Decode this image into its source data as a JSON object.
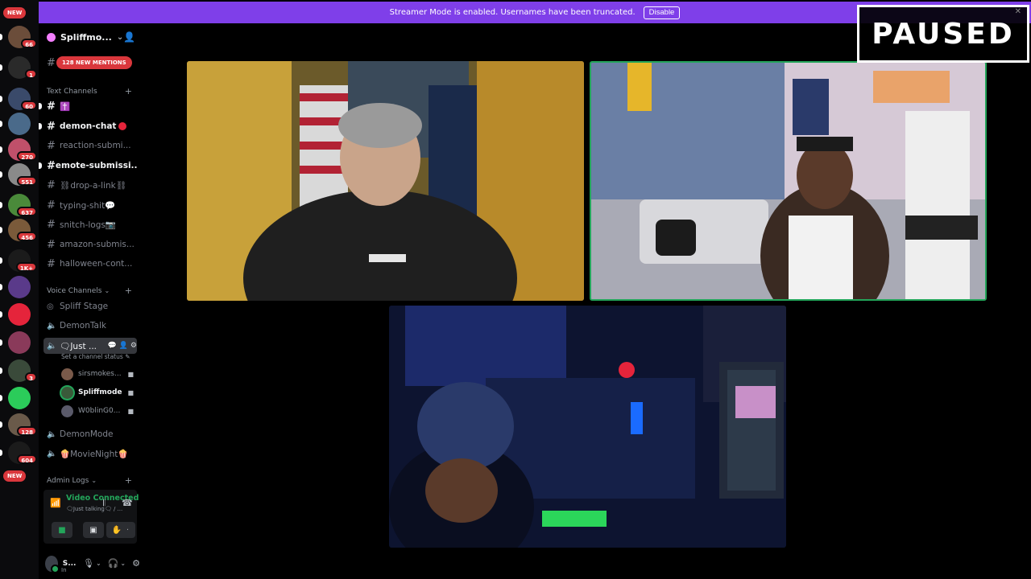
{
  "banner": {
    "text": "Streamer Mode is enabled. Usernames have been truncated.",
    "button": "Disable"
  },
  "overlay": {
    "paused": "PAUSED"
  },
  "rail": {
    "top_badge": "NEW",
    "servers": [
      {
        "badge": "66",
        "color": "#6b4d3a"
      },
      {
        "badge": "1",
        "color": "#2a2a2a"
      },
      {
        "badge": "60",
        "color": "#3a4a6a"
      },
      {
        "badge": "",
        "color": "#4a6a8a"
      },
      {
        "badge": "270",
        "color": "#c0506a"
      },
      {
        "badge": "551",
        "color": "#8a8a8a"
      },
      {
        "badge": "637",
        "color": "#4a8a3a"
      },
      {
        "badge": "456",
        "color": "#7a5a3a"
      },
      {
        "badge": "1K+",
        "color": "#1b1b1b"
      },
      {
        "badge": "",
        "color": "#5a3a8a"
      },
      {
        "badge": "",
        "color": "#e5243b"
      },
      {
        "badge": "",
        "color": "#8a3a5a"
      },
      {
        "badge": "3",
        "color": "#3a4a3a"
      },
      {
        "badge": "",
        "color": "#2bcc5a"
      },
      {
        "badge": "128",
        "color": "#6a5a4a"
      },
      {
        "badge": "604",
        "color": "#1b1b1b"
      }
    ],
    "bottom_badge": "NEW"
  },
  "sidebar": {
    "server_name": "Spliffmo...",
    "mentions": "128 NEW MENTIONS",
    "text_category": "Text Channels",
    "text_channels": [
      {
        "name": "✝️",
        "unread": true
      },
      {
        "name": "demon-chat",
        "unread": true
      },
      {
        "name": "reaction-submi...",
        "unread": false
      },
      {
        "name": "emote-submissi...",
        "unread": true
      },
      {
        "name": "⛓drop-a-link⛓",
        "unread": false
      },
      {
        "name": "typing-shit💬",
        "unread": false
      },
      {
        "name": "snitch-logs📷",
        "unread": false
      },
      {
        "name": "amazon-submis...",
        "unread": false
      },
      {
        "name": "halloween-cont...",
        "unread": false
      }
    ],
    "voice_category": "Voice Channels",
    "voice_channels": [
      {
        "name": "Spliff Stage"
      },
      {
        "name": "DemonTalk"
      },
      {
        "name": "🗨Just ...",
        "active": true
      }
    ],
    "channel_status": "Set a channel status",
    "voice_users": [
      {
        "name": "sirsmokes...",
        "me": false
      },
      {
        "name": "Spliffmode",
        "me": true
      },
      {
        "name": "W0blinG0...",
        "me": false
      }
    ],
    "more_voice": [
      {
        "name": "DemonMode"
      },
      {
        "name": "🍿MovieNight🍿"
      }
    ],
    "admin_category": "Admin Logs",
    "voice_panel": {
      "status": "Video Connected",
      "channel": "🗨Just talking🗨 / ..."
    },
    "user": {
      "name": "S...",
      "status": "In"
    }
  },
  "colors": {
    "banner": "#7f3fe9",
    "speaking": "#23a55a",
    "badge": "#da373c"
  }
}
